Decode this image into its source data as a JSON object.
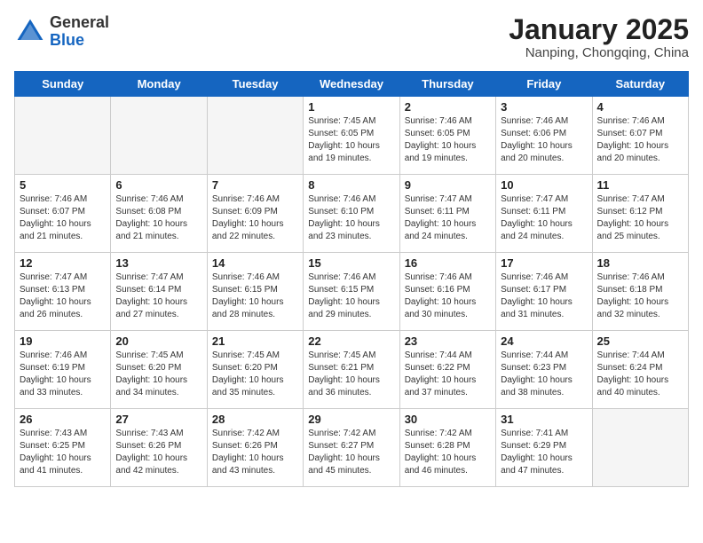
{
  "header": {
    "logo_general": "General",
    "logo_blue": "Blue",
    "month_title": "January 2025",
    "location": "Nanping, Chongqing, China"
  },
  "weekdays": [
    "Sunday",
    "Monday",
    "Tuesday",
    "Wednesday",
    "Thursday",
    "Friday",
    "Saturday"
  ],
  "weeks": [
    [
      {
        "day": "",
        "empty": true
      },
      {
        "day": "",
        "empty": true
      },
      {
        "day": "",
        "empty": true
      },
      {
        "day": "1",
        "sunrise": "Sunrise: 7:45 AM",
        "sunset": "Sunset: 6:05 PM",
        "daylight": "Daylight: 10 hours and 19 minutes."
      },
      {
        "day": "2",
        "sunrise": "Sunrise: 7:46 AM",
        "sunset": "Sunset: 6:05 PM",
        "daylight": "Daylight: 10 hours and 19 minutes."
      },
      {
        "day": "3",
        "sunrise": "Sunrise: 7:46 AM",
        "sunset": "Sunset: 6:06 PM",
        "daylight": "Daylight: 10 hours and 20 minutes."
      },
      {
        "day": "4",
        "sunrise": "Sunrise: 7:46 AM",
        "sunset": "Sunset: 6:07 PM",
        "daylight": "Daylight: 10 hours and 20 minutes."
      }
    ],
    [
      {
        "day": "5",
        "sunrise": "Sunrise: 7:46 AM",
        "sunset": "Sunset: 6:07 PM",
        "daylight": "Daylight: 10 hours and 21 minutes."
      },
      {
        "day": "6",
        "sunrise": "Sunrise: 7:46 AM",
        "sunset": "Sunset: 6:08 PM",
        "daylight": "Daylight: 10 hours and 21 minutes."
      },
      {
        "day": "7",
        "sunrise": "Sunrise: 7:46 AM",
        "sunset": "Sunset: 6:09 PM",
        "daylight": "Daylight: 10 hours and 22 minutes."
      },
      {
        "day": "8",
        "sunrise": "Sunrise: 7:46 AM",
        "sunset": "Sunset: 6:10 PM",
        "daylight": "Daylight: 10 hours and 23 minutes."
      },
      {
        "day": "9",
        "sunrise": "Sunrise: 7:47 AM",
        "sunset": "Sunset: 6:11 PM",
        "daylight": "Daylight: 10 hours and 24 minutes."
      },
      {
        "day": "10",
        "sunrise": "Sunrise: 7:47 AM",
        "sunset": "Sunset: 6:11 PM",
        "daylight": "Daylight: 10 hours and 24 minutes."
      },
      {
        "day": "11",
        "sunrise": "Sunrise: 7:47 AM",
        "sunset": "Sunset: 6:12 PM",
        "daylight": "Daylight: 10 hours and 25 minutes."
      }
    ],
    [
      {
        "day": "12",
        "sunrise": "Sunrise: 7:47 AM",
        "sunset": "Sunset: 6:13 PM",
        "daylight": "Daylight: 10 hours and 26 minutes."
      },
      {
        "day": "13",
        "sunrise": "Sunrise: 7:47 AM",
        "sunset": "Sunset: 6:14 PM",
        "daylight": "Daylight: 10 hours and 27 minutes."
      },
      {
        "day": "14",
        "sunrise": "Sunrise: 7:46 AM",
        "sunset": "Sunset: 6:15 PM",
        "daylight": "Daylight: 10 hours and 28 minutes."
      },
      {
        "day": "15",
        "sunrise": "Sunrise: 7:46 AM",
        "sunset": "Sunset: 6:15 PM",
        "daylight": "Daylight: 10 hours and 29 minutes."
      },
      {
        "day": "16",
        "sunrise": "Sunrise: 7:46 AM",
        "sunset": "Sunset: 6:16 PM",
        "daylight": "Daylight: 10 hours and 30 minutes."
      },
      {
        "day": "17",
        "sunrise": "Sunrise: 7:46 AM",
        "sunset": "Sunset: 6:17 PM",
        "daylight": "Daylight: 10 hours and 31 minutes."
      },
      {
        "day": "18",
        "sunrise": "Sunrise: 7:46 AM",
        "sunset": "Sunset: 6:18 PM",
        "daylight": "Daylight: 10 hours and 32 minutes."
      }
    ],
    [
      {
        "day": "19",
        "sunrise": "Sunrise: 7:46 AM",
        "sunset": "Sunset: 6:19 PM",
        "daylight": "Daylight: 10 hours and 33 minutes."
      },
      {
        "day": "20",
        "sunrise": "Sunrise: 7:45 AM",
        "sunset": "Sunset: 6:20 PM",
        "daylight": "Daylight: 10 hours and 34 minutes."
      },
      {
        "day": "21",
        "sunrise": "Sunrise: 7:45 AM",
        "sunset": "Sunset: 6:20 PM",
        "daylight": "Daylight: 10 hours and 35 minutes."
      },
      {
        "day": "22",
        "sunrise": "Sunrise: 7:45 AM",
        "sunset": "Sunset: 6:21 PM",
        "daylight": "Daylight: 10 hours and 36 minutes."
      },
      {
        "day": "23",
        "sunrise": "Sunrise: 7:44 AM",
        "sunset": "Sunset: 6:22 PM",
        "daylight": "Daylight: 10 hours and 37 minutes."
      },
      {
        "day": "24",
        "sunrise": "Sunrise: 7:44 AM",
        "sunset": "Sunset: 6:23 PM",
        "daylight": "Daylight: 10 hours and 38 minutes."
      },
      {
        "day": "25",
        "sunrise": "Sunrise: 7:44 AM",
        "sunset": "Sunset: 6:24 PM",
        "daylight": "Daylight: 10 hours and 40 minutes."
      }
    ],
    [
      {
        "day": "26",
        "sunrise": "Sunrise: 7:43 AM",
        "sunset": "Sunset: 6:25 PM",
        "daylight": "Daylight: 10 hours and 41 minutes."
      },
      {
        "day": "27",
        "sunrise": "Sunrise: 7:43 AM",
        "sunset": "Sunset: 6:26 PM",
        "daylight": "Daylight: 10 hours and 42 minutes."
      },
      {
        "day": "28",
        "sunrise": "Sunrise: 7:42 AM",
        "sunset": "Sunset: 6:26 PM",
        "daylight": "Daylight: 10 hours and 43 minutes."
      },
      {
        "day": "29",
        "sunrise": "Sunrise: 7:42 AM",
        "sunset": "Sunset: 6:27 PM",
        "daylight": "Daylight: 10 hours and 45 minutes."
      },
      {
        "day": "30",
        "sunrise": "Sunrise: 7:42 AM",
        "sunset": "Sunset: 6:28 PM",
        "daylight": "Daylight: 10 hours and 46 minutes."
      },
      {
        "day": "31",
        "sunrise": "Sunrise: 7:41 AM",
        "sunset": "Sunset: 6:29 PM",
        "daylight": "Daylight: 10 hours and 47 minutes."
      },
      {
        "day": "",
        "empty": true
      }
    ]
  ]
}
